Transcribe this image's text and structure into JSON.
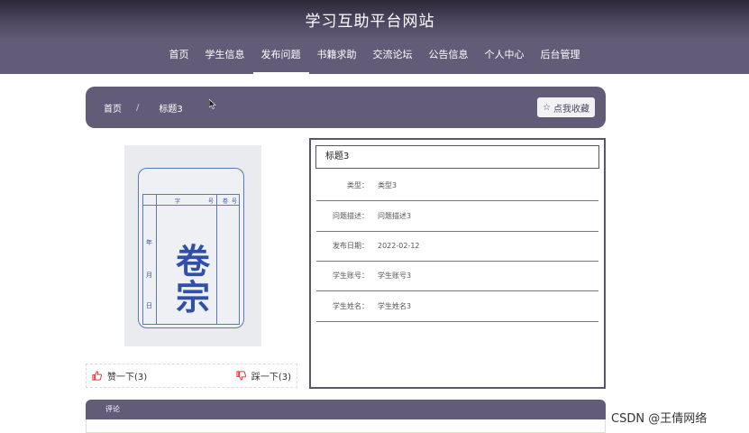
{
  "header": {
    "site_title": "学习互助平台网站"
  },
  "nav": {
    "items": [
      {
        "label": "首页"
      },
      {
        "label": "学生信息"
      },
      {
        "label": "发布问题",
        "active": true
      },
      {
        "label": "书籍求助"
      },
      {
        "label": "交流论坛"
      },
      {
        "label": "公告信息"
      },
      {
        "label": "个人中心"
      },
      {
        "label": "后台管理"
      }
    ]
  },
  "breadcrumb": {
    "home": "首页",
    "separator": "/",
    "current": "标题3"
  },
  "favorite_button": {
    "label": "点我收藏",
    "icon": "star-outline-icon"
  },
  "image": {
    "description_icon": "dossier-folder-photo",
    "big_text_1": "卷",
    "big_text_2": "宗",
    "side_labels": [
      "年",
      "月",
      "日"
    ],
    "top_labels": [
      "字",
      "号",
      "卷",
      "号"
    ]
  },
  "votes": {
    "up_label": "赞一下(3)",
    "down_label": "踩一下(3)",
    "up_icon": "thumbs-up-icon",
    "down_icon": "thumbs-down-icon",
    "icon_color": "#e0383e"
  },
  "detail": {
    "title": "标题3",
    "rows": [
      {
        "label": "类型：",
        "value": "类型3"
      },
      {
        "label": "问题描述：",
        "value": "问题描述3"
      },
      {
        "label": "发布日期：",
        "value": "2022-02-12"
      },
      {
        "label": "学生账号：",
        "value": "学生账号3"
      },
      {
        "label": "学生姓名：",
        "value": "学生姓名3"
      }
    ]
  },
  "comments": {
    "label": "评论"
  },
  "watermark": "CSDN @王倩网络",
  "colors": {
    "accent": "#625c78",
    "header_dark": "#2b2736",
    "folder_blue": "#3050a8"
  }
}
